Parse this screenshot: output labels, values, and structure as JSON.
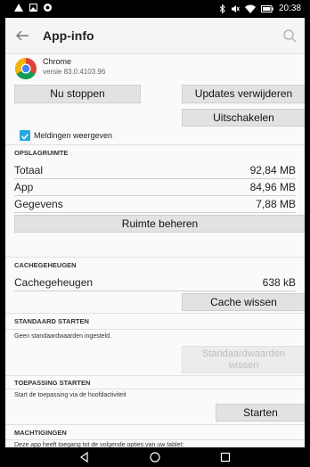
{
  "status_bar": {
    "time": "20:38"
  },
  "app_bar": {
    "title": "App-info"
  },
  "app": {
    "name": "Chrome",
    "version": "versie 83.0.4103.96"
  },
  "buttons": {
    "force_stop": "Nu stoppen",
    "uninstall_updates": "Updates verwijderen",
    "disable": "Uitschakelen",
    "manage_space": "Ruimte beheren",
    "clear_cache": "Cache wissen",
    "clear_defaults_line1": "Standaardwaarden",
    "clear_defaults_line2": "wissen",
    "launch": "Starten"
  },
  "notifications": {
    "label": "Meldingen weergeven",
    "checked": true
  },
  "storage": {
    "header": "OPSLAGRUIMTE",
    "rows": [
      {
        "label": "Totaal",
        "value": "92,84 MB"
      },
      {
        "label": "App",
        "value": "84,96 MB"
      },
      {
        "label": "Gegevens",
        "value": "7,88 MB"
      }
    ]
  },
  "cache": {
    "header": "CACHEGEHEUGEN",
    "label": "Cachegeheugen",
    "value": "638 kB"
  },
  "default_launch": {
    "header": "STANDAARD STARTEN",
    "text": "Geen standaardwaarden ingesteld."
  },
  "app_launch": {
    "header": "TOEPASSING STARTEN",
    "text": "Start de toepassing via de hoofdactiviteit"
  },
  "permissions": {
    "header": "MACHTIGINGEN",
    "text": "Deze app heeft toegang tot de volgende opties van uw tablet:"
  },
  "colors": {
    "accent": "#29a8e0",
    "button_bg": "#e2e2e2",
    "background": "#fafafa"
  }
}
